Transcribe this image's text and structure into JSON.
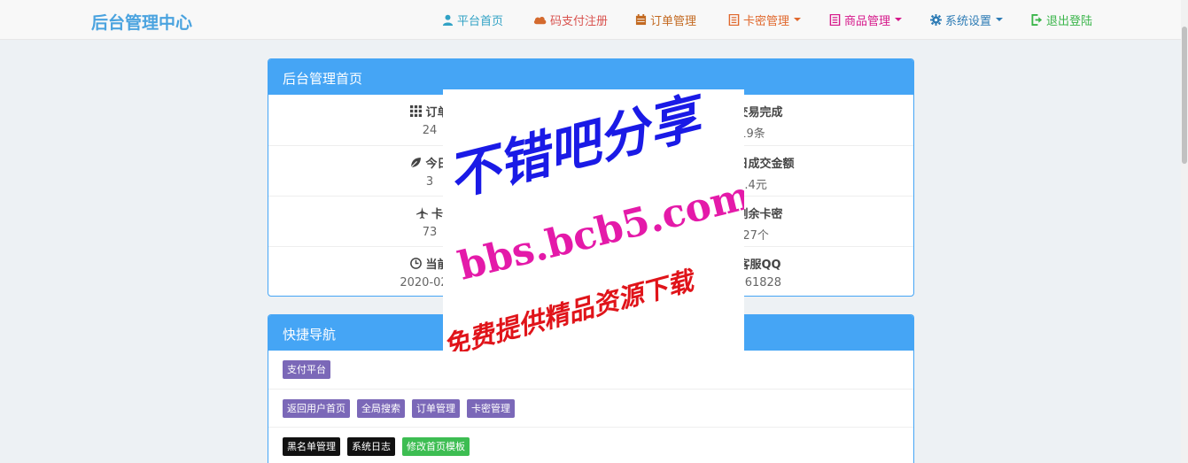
{
  "brand": "后台管理中心",
  "nav": [
    {
      "label": "平台首页",
      "icon": "user-icon",
      "color": "#31a2c5",
      "caret": false
    },
    {
      "label": "码支付注册",
      "icon": "cloud-icon",
      "color": "#d9534f",
      "caret": false
    },
    {
      "label": "订单管理",
      "icon": "calendar-icon",
      "color": "#c36a22",
      "caret": false
    },
    {
      "label": "卡密管理",
      "icon": "list-icon",
      "color": "#e0682d",
      "caret": true
    },
    {
      "label": "商品管理",
      "icon": "list-icon",
      "color": "#d6198b",
      "caret": true
    },
    {
      "label": "系统设置",
      "icon": "gear-icon",
      "color": "#2d7bb5",
      "caret": true
    },
    {
      "label": "退出登陆",
      "icon": "logout-icon",
      "color": "#3ab54a",
      "caret": false
    }
  ],
  "dashboard": {
    "title": "后台管理首页",
    "rows": [
      [
        {
          "label": "订单",
          "value": "24",
          "icon": "grid-icon"
        },
        {
          "label": "交易完成",
          "value": "19条",
          "icon": "check-icon"
        }
      ],
      [
        {
          "label": "今日",
          "value": "3",
          "icon": "leaf-icon"
        },
        {
          "label": "今日成交金额",
          "value": "0.4元",
          "icon": "chart-icon"
        }
      ],
      [
        {
          "label": "卡",
          "value": "73",
          "icon": "plane-icon"
        },
        {
          "label": "剩余卡密",
          "value": "727个",
          "icon": "key-icon"
        }
      ],
      [
        {
          "label": "当前",
          "value": "2020-02-0",
          "icon": "clock-icon"
        },
        {
          "label": "客服QQ",
          "value": "43161828",
          "icon": "question-icon"
        }
      ]
    ]
  },
  "quicknav": {
    "title": "快捷导航",
    "rows": [
      [
        {
          "label": "支付平台",
          "color": "#7b68b8"
        }
      ],
      [
        {
          "label": "返回用户首页",
          "color": "#7b68b8"
        },
        {
          "label": "全局搜索",
          "color": "#7b68b8"
        },
        {
          "label": "订单管理",
          "color": "#7b68b8"
        },
        {
          "label": "卡密管理",
          "color": "#7b68b8"
        }
      ],
      [
        {
          "label": "黑名单管理",
          "color": "#111111"
        },
        {
          "label": "系统日志",
          "color": "#111111"
        },
        {
          "label": "修改首页模板",
          "color": "#3dbd52"
        }
      ]
    ]
  },
  "watermark": {
    "line1": "不错吧分享",
    "line2": "bbs.bcb5.com",
    "line3": "免费提供精品资源下载"
  }
}
